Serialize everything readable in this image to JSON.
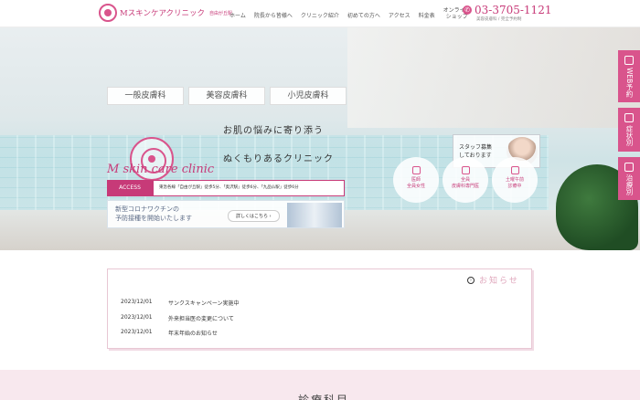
{
  "header": {
    "logo_text": "Mスキンケアクリニック",
    "logo_sub": "自由が丘駅",
    "nav": [
      "ホーム",
      "院長から皆様へ",
      "クリニック紹介",
      "初めての方へ",
      "アクセス",
      "料金表"
    ],
    "online_line1": "オンライン",
    "online_line2": "ショップ",
    "phone": "03-3705-1121",
    "phone_sub": "美容皮膚科 / 完全予約制"
  },
  "hero": {
    "tabs": [
      "一般皮膚科",
      "美容皮膚科",
      "小児皮膚科"
    ],
    "brand": "M skin care clinic",
    "catch1": "お肌の悩みに寄り添う",
    "catch2": "ぬくもりあるクリニック",
    "access_label": "ACCESS",
    "access_text": "東急各線「自由が丘駅」徒歩5分、「奥沢駅」徒歩6分、「九品仏駅」徒歩6分",
    "vaccine_line1": "新型コロナワクチンの",
    "vaccine_line2": "予防接種を開始いたします",
    "vaccine_btn": "詳しくはこちら ›",
    "recruit_line1": "スタッフ募集",
    "recruit_line2": "しております",
    "circles": [
      {
        "l1": "医師",
        "l2": "全員女性"
      },
      {
        "l1": "全員",
        "l2": "皮膚科専門医"
      },
      {
        "l1": "土曜午前",
        "l2": "診療中"
      }
    ]
  },
  "side_tabs": [
    {
      "label": "WEB予約"
    },
    {
      "label": "症状別"
    },
    {
      "label": "治療別"
    }
  ],
  "news": {
    "title": "お知らせ",
    "items": [
      {
        "date": "2023/12/01",
        "text": "サンクスキャンペーン実施中"
      },
      {
        "date": "2023/12/01",
        "text": "外来担当医の変更について"
      },
      {
        "date": "2023/12/01",
        "text": "年末年始のお知らせ"
      }
    ]
  },
  "section": {
    "title": "診療科目"
  }
}
